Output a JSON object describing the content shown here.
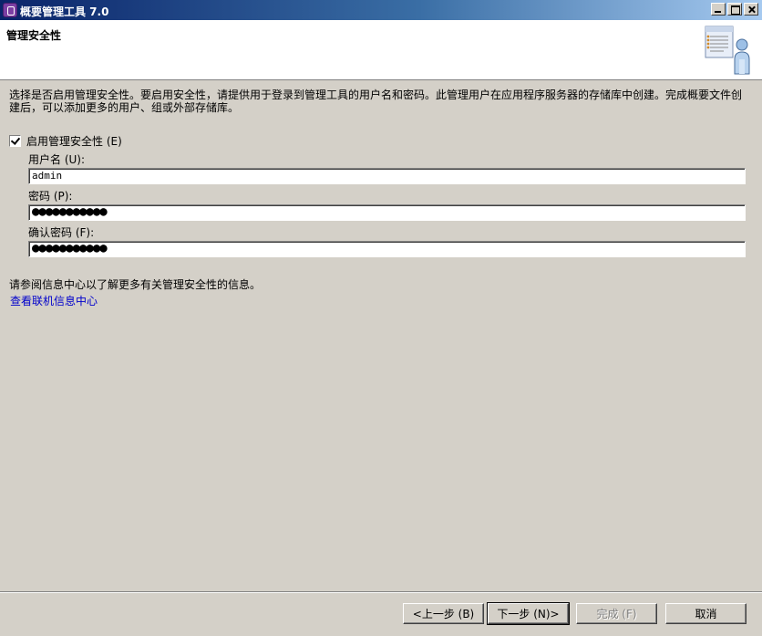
{
  "window": {
    "title": "概要管理工具 7.0"
  },
  "header": {
    "title": "管理安全性"
  },
  "description": "选择是否启用管理安全性。要启用安全性，请提供用于登录到管理工具的用户名和密码。此管理用户在应用程序服务器的存储库中创建。完成概要文件创建后，可以添加更多的用户、组或外部存储库。",
  "security": {
    "enable_label": "启用管理安全性 (E)",
    "enabled": true
  },
  "fields": {
    "username_label": "用户名 (U):",
    "username_value": "admin",
    "password_label": "密码 (P):",
    "password_value": "●●●●●●●●●●●",
    "confirm_label": "确认密码 (F):",
    "confirm_value": "●●●●●●●●●●●"
  },
  "info_text": "请参阅信息中心以了解更多有关管理安全性的信息。",
  "info_link": "查看联机信息中心",
  "buttons": {
    "back": "<上一步 (B)",
    "next": "下一步 (N)>",
    "finish": "完成 (F)",
    "cancel": "取消"
  },
  "colors": {
    "titlebar_start": "#0a246a",
    "link": "#0000cc",
    "dialog_bg": "#d4d0c8"
  },
  "icons": [
    "app-icon",
    "minimize-icon",
    "maximize-icon",
    "close-icon",
    "wizard-banner-icon",
    "checkbox-checked-icon"
  ]
}
